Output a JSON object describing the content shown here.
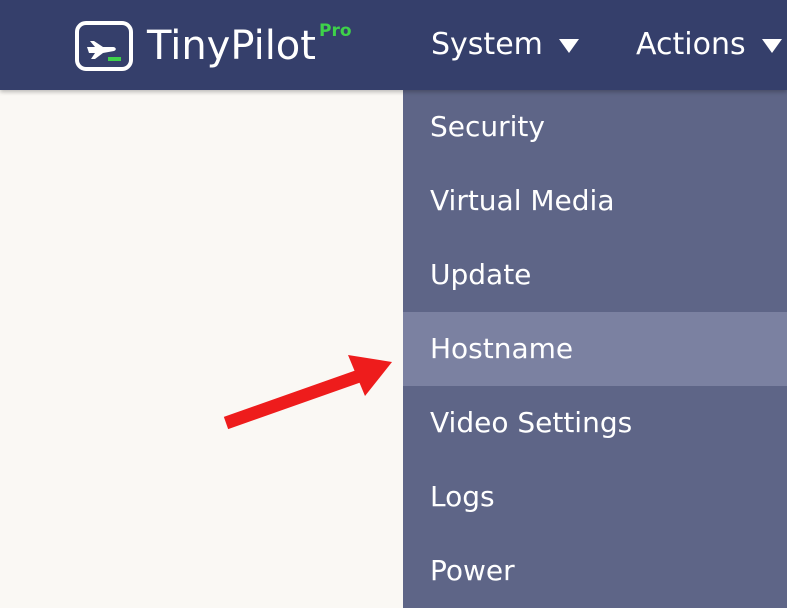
{
  "app": {
    "brand_name": "TinyPilot",
    "brand_tier": "Pro",
    "brand_icon": "airplane-takeoff-icon"
  },
  "nav": {
    "items": [
      {
        "label": "System"
      },
      {
        "label": "Actions"
      }
    ]
  },
  "system_menu": {
    "open": true,
    "highlighted": "Hostname",
    "items": [
      {
        "label": "Security"
      },
      {
        "label": "Virtual Media"
      },
      {
        "label": "Update"
      },
      {
        "label": "Hostname"
      },
      {
        "label": "Video Settings"
      },
      {
        "label": "Logs"
      },
      {
        "label": "Power"
      }
    ]
  },
  "colors": {
    "navbar": "#353f6b",
    "dropdown": "#5e6587",
    "dropdown_highlight": "#7b81a1",
    "pro_badge": "#3ed14a",
    "page_background": "#faf8f4",
    "annotation_arrow": "#ee1c1c"
  }
}
